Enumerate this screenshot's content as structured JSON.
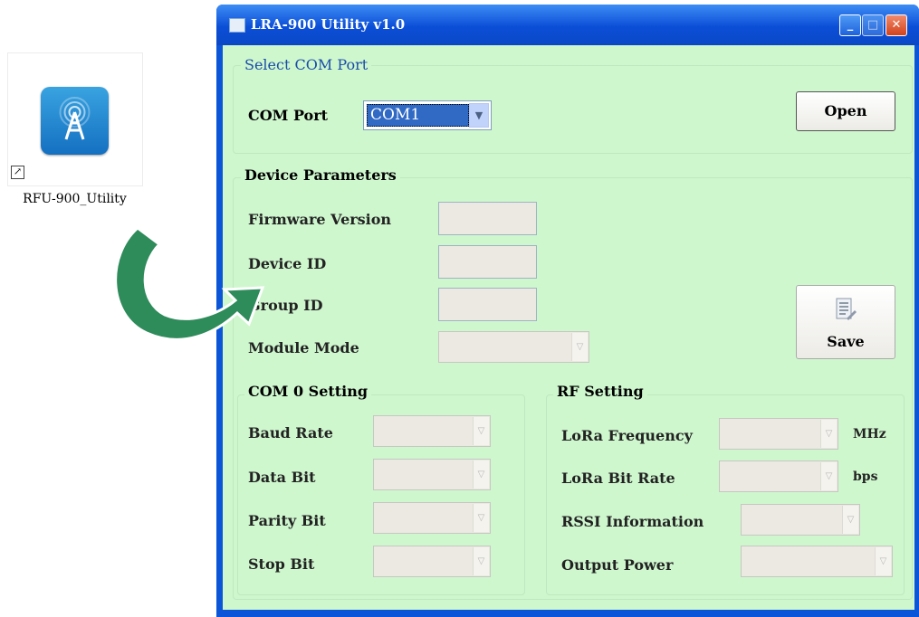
{
  "desktop": {
    "shortcut_label": "RFU-900_Utility",
    "icon": "antenna-tower-icon",
    "shortcut_glyph": "↗"
  },
  "window": {
    "title": "LRA-900 Utility v1.0",
    "controls": {
      "minimize": "_",
      "maximize": "□",
      "close": "✕"
    }
  },
  "com_port_group": {
    "title": "Select COM Port",
    "label": "COM Port",
    "selected": "COM1",
    "open_button": "Open"
  },
  "device_group": {
    "title": "Device Parameters",
    "firmware_label": "Firmware Version",
    "device_id_label": "Device ID",
    "group_id_label": "Group ID",
    "module_mode_label": "Module Mode",
    "save_button": "Save"
  },
  "com0_group": {
    "title": "COM 0 Setting",
    "baud_label": "Baud Rate",
    "data_bit_label": "Data Bit",
    "parity_label": "Parity Bit",
    "stop_bit_label": "Stop Bit"
  },
  "rf_group": {
    "title": "RF Setting",
    "freq_label": "LoRa Frequency",
    "freq_unit": "MHz",
    "bitrate_label": "LoRa Bit Rate",
    "bitrate_unit": "bps",
    "rssi_label": "RSSI Information",
    "power_label": "Output Power"
  },
  "colors": {
    "client_bg": "#cff7ce",
    "titlebar": "#0b4ed7",
    "arrow": "#2e8b5a",
    "selection": "#316ac5"
  }
}
